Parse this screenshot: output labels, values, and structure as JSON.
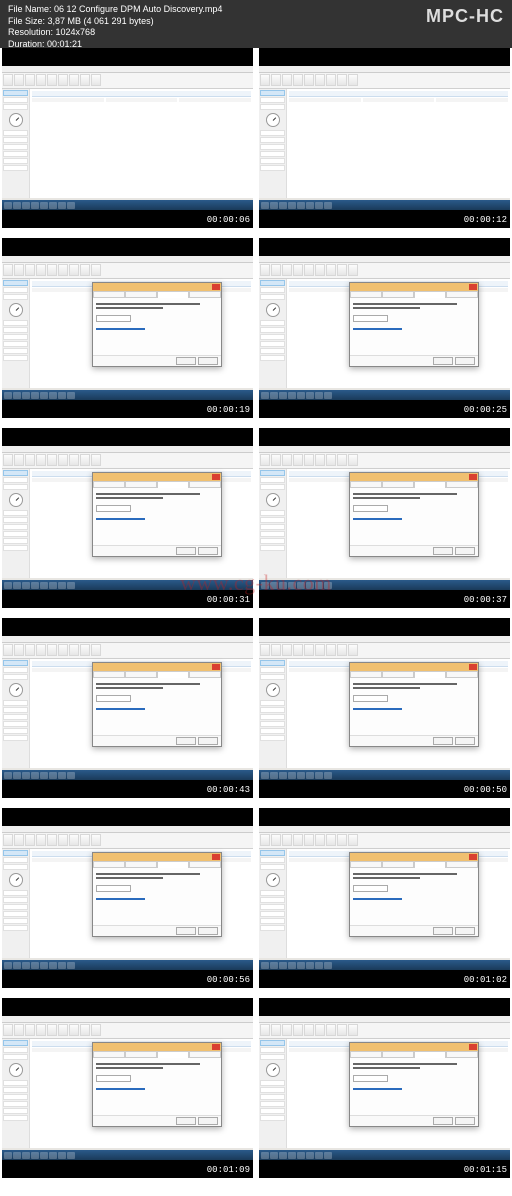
{
  "header": {
    "file_name_label": "File Name: ",
    "file_name": "06 12 Configure DPM Auto Discovery.mp4",
    "file_size_label": "File Size: ",
    "file_size": "3,87 MB (4 061 291 bytes)",
    "resolution_label": "Resolution: ",
    "resolution": "1024x768",
    "duration_label": "Duration: ",
    "duration": "00:01:21",
    "player": "MPC-HC"
  },
  "watermark": "www.cg-ku.com",
  "thumbs": [
    {
      "ts": "00:00:06",
      "dialog": false
    },
    {
      "ts": "00:00:12",
      "dialog": false
    },
    {
      "ts": "00:00:19",
      "dialog": true
    },
    {
      "ts": "00:00:25",
      "dialog": true
    },
    {
      "ts": "00:00:31",
      "dialog": true
    },
    {
      "ts": "00:00:37",
      "dialog": true
    },
    {
      "ts": "00:00:43",
      "dialog": true
    },
    {
      "ts": "00:00:50",
      "dialog": true
    },
    {
      "ts": "00:00:56",
      "dialog": true
    },
    {
      "ts": "00:01:02",
      "dialog": true
    },
    {
      "ts": "00:01:09",
      "dialog": true
    },
    {
      "ts": "00:01:15",
      "dialog": true
    }
  ]
}
